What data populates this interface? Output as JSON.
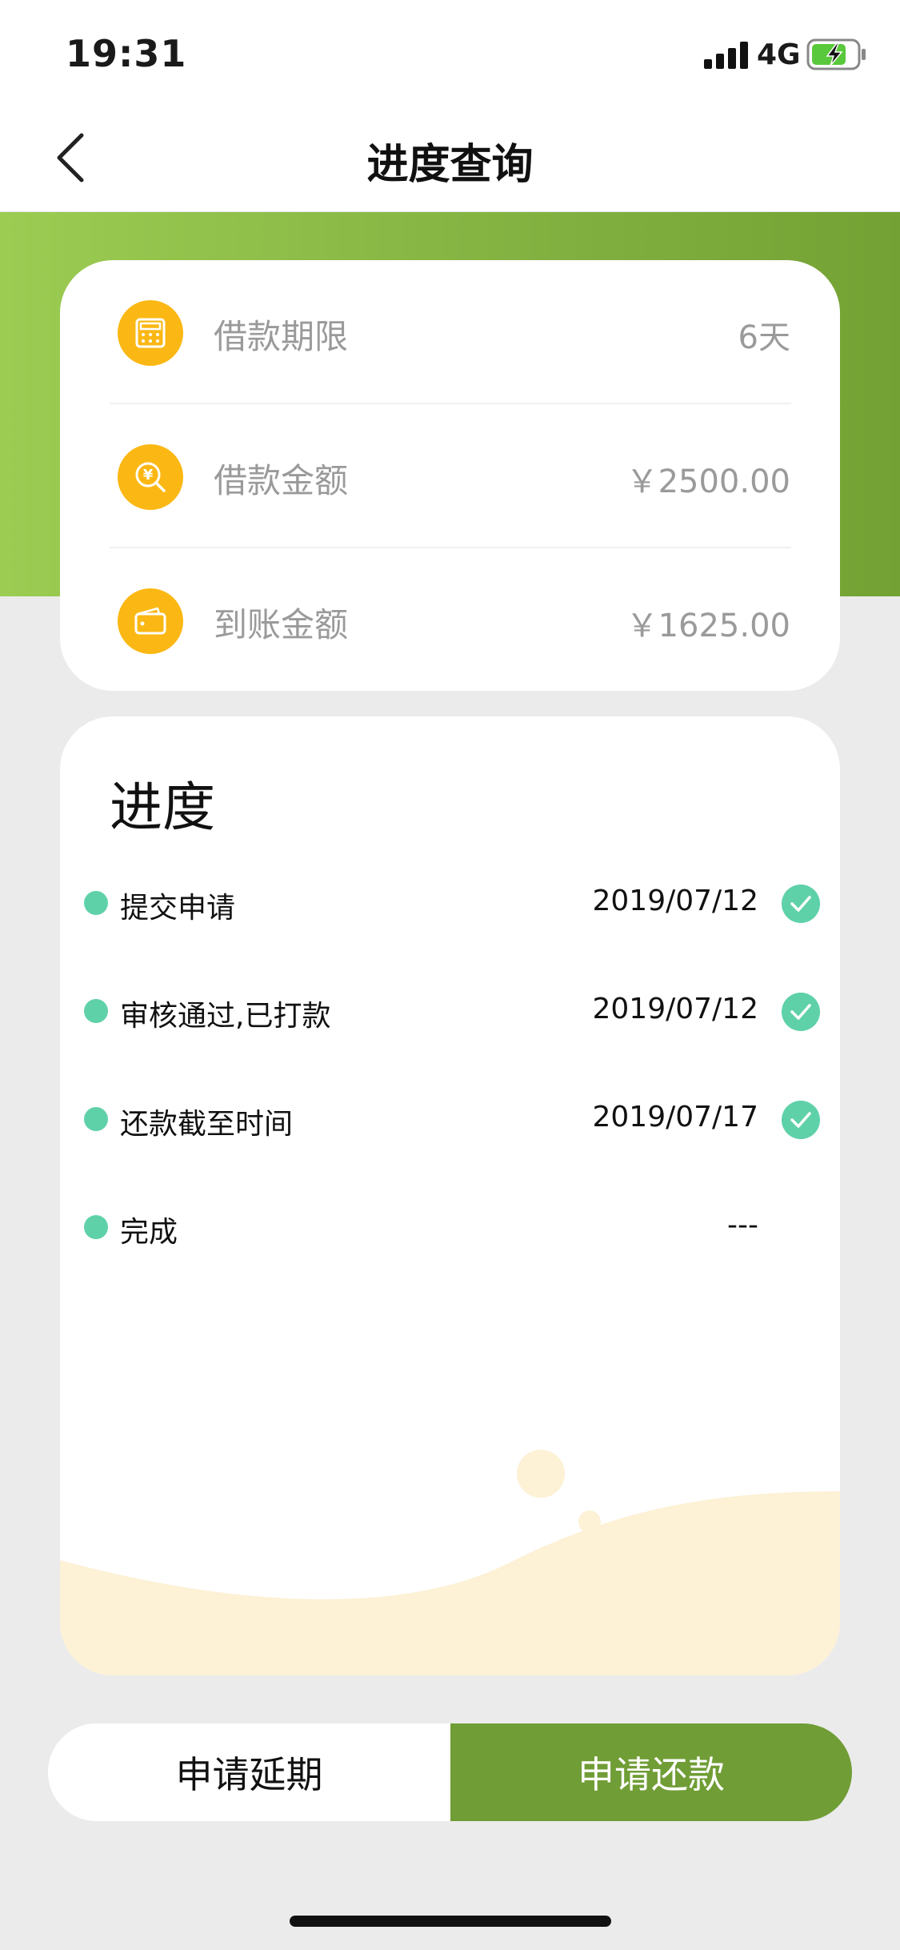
{
  "status_bar": {
    "time": "19:31",
    "network": "4G"
  },
  "header": {
    "title": "进度查询"
  },
  "loan_info": [
    {
      "icon": "calculator-icon",
      "label": "借款期限",
      "value": "6天"
    },
    {
      "icon": "yen-search-icon",
      "label": "借款金额",
      "value": "￥2500.00"
    },
    {
      "icon": "wallet-icon",
      "label": "到账金额",
      "value": "￥1625.00"
    }
  ],
  "progress": {
    "title": "进度",
    "steps": [
      {
        "label": "提交申请",
        "date": "2019/07/12",
        "done": true
      },
      {
        "label": "审核通过,已打款",
        "date": "2019/07/12",
        "done": true
      },
      {
        "label": "还款截至时间",
        "date": "2019/07/17",
        "done": true
      },
      {
        "label": "完成",
        "date": "---",
        "done": false
      }
    ]
  },
  "actions": {
    "extend_label": "申请延期",
    "repay_label": "申请还款"
  },
  "colors": {
    "accent_green": "#709d36",
    "step_teal": "#5fd1a8",
    "icon_orange": "#fbb814"
  }
}
